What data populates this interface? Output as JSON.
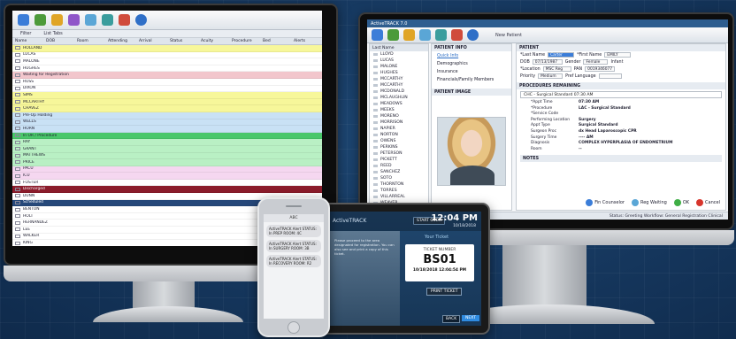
{
  "left_app": {
    "tabs": [
      "Filter",
      "List Tabs"
    ],
    "columns": [
      "Name",
      "DOB",
      "Room",
      "Attending",
      "Arrival",
      "Status",
      "Acuity",
      "Procedure",
      "Bed",
      "Alerts"
    ],
    "rows": [
      {
        "name": "HOLLAND",
        "dob": "",
        "room": "",
        "status": "",
        "color": "#f7f79a"
      },
      {
        "name": "LUCAS",
        "dob": "08/22",
        "room": "",
        "status": "",
        "color": "#ffffff"
      },
      {
        "name": "MALONE",
        "dob": "",
        "room": "",
        "status": "",
        "color": "#ffffff"
      },
      {
        "name": "HUGHES",
        "dob": "",
        "room": "",
        "status": "",
        "color": "#ffffff"
      },
      {
        "name": "Waiting for Registration",
        "dob": "",
        "room": "",
        "status": "",
        "color": "#f2c6cc"
      },
      {
        "name": "ROSS",
        "dob": "",
        "room": "",
        "status": "",
        "color": "#ffffff"
      },
      {
        "name": "DIXON",
        "dob": "",
        "room": "",
        "status": "",
        "color": "#ffffff"
      },
      {
        "name": "SIMS",
        "dob": "",
        "room": "",
        "status": "",
        "color": "#f7f79a"
      },
      {
        "name": "MCCARTHY",
        "dob": "",
        "room": "",
        "status": "",
        "color": "#f7f79a"
      },
      {
        "name": "CHAVEZ",
        "dob": "",
        "room": "",
        "status": "",
        "color": "#f7f79a"
      },
      {
        "name": "Pre-Op Holding",
        "dob": "",
        "room": "",
        "status": "",
        "color": "#c9e1f5"
      },
      {
        "name": "WELLS",
        "dob": "",
        "room": "",
        "status": "",
        "color": "#c9e1f5"
      },
      {
        "name": "HORN",
        "dob": "",
        "room": "",
        "status": "",
        "color": "#c9e1f5"
      },
      {
        "name": "In OR / Procedure",
        "dob": "",
        "room": "",
        "status": "",
        "color": "#49c76a"
      },
      {
        "name": "RAY",
        "dob": "",
        "room": "",
        "status": "",
        "color": "#b9f0c4"
      },
      {
        "name": "GRANT",
        "dob": "",
        "room": "",
        "status": "",
        "color": "#b9f0c4"
      },
      {
        "name": "MATTHEWS",
        "dob": "",
        "room": "",
        "status": "",
        "color": "#b9f0c4"
      },
      {
        "name": "PRICE",
        "dob": "",
        "room": "",
        "status": "",
        "color": "#b9f0c4"
      },
      {
        "name": "PACU",
        "dob": "",
        "room": "",
        "status": "",
        "color": "#f5d7f0"
      },
      {
        "name": "ICU",
        "dob": "",
        "room": "",
        "status": "",
        "color": "#f5d7f0"
      },
      {
        "name": "FOSTER",
        "dob": "",
        "room": "",
        "status": "",
        "color": "#ffffff"
      },
      {
        "name": "Discharged",
        "dob": "",
        "room": "",
        "status": "",
        "color": "#8b1c2b"
      },
      {
        "name": "DUNN",
        "dob": "",
        "room": "",
        "status": "",
        "color": "#ffffff"
      },
      {
        "name": "Scheduled",
        "dob": "",
        "room": "",
        "status": "",
        "color": "#26487a"
      },
      {
        "name": "BENTON",
        "dob": "",
        "room": "",
        "status": "",
        "color": "#ffffff"
      },
      {
        "name": "HOLT",
        "dob": "",
        "room": "",
        "status": "",
        "color": "#ffffff"
      },
      {
        "name": "HERNANDEZ",
        "dob": "",
        "room": "",
        "status": "",
        "color": "#ffffff"
      },
      {
        "name": "LEE",
        "dob": "",
        "room": "",
        "status": "",
        "color": "#ffffff"
      },
      {
        "name": "WALKER",
        "dob": "",
        "room": "",
        "status": "",
        "color": "#ffffff"
      },
      {
        "name": "KING",
        "dob": "",
        "room": "",
        "status": "",
        "color": "#ffffff"
      },
      {
        "name": "ROBERTS",
        "dob": "",
        "room": "",
        "status": "",
        "color": "#ffffff"
      },
      {
        "name": "YOUNG",
        "dob": "",
        "room": "",
        "status": "",
        "color": "#ffffff"
      },
      {
        "name": "SMITH",
        "dob": "",
        "room": "",
        "status": "",
        "color": "#ffffff"
      },
      {
        "name": "Cancelled",
        "dob": "",
        "room": "",
        "status": "",
        "color": "#f1b26a"
      }
    ]
  },
  "right_app": {
    "title": "ActiveTRACK 7.0",
    "tab_label": "New Patient",
    "names_header": "Last Name",
    "names": [
      "LLOYD",
      "LUCAS",
      "MALONE",
      "HUGHES",
      "MCCARTHY",
      "MCCARTHY",
      "MCDONALD",
      "MCLAUGHLIN",
      "MEADOWS",
      "MEEKS",
      "MORENO",
      "MORRISON",
      "NAPIER",
      "NORTON",
      "OWENS",
      "PERKINS",
      "PETERSON",
      "PICKETT",
      "REED",
      "SANCHEZ",
      "SOTO",
      "THORNTON",
      "TORRES",
      "VILLARREAL",
      "WEAVER",
      "WILLIAMSON"
    ],
    "patient_info_header": "PATIENT INFO",
    "info_links": [
      "Quick Info",
      "Demographics",
      "Insurance",
      "Financials/Family Members"
    ],
    "patient_image_header": "PATIENT IMAGE",
    "form_header": "PATIENT",
    "last_name_label": "*Last Name",
    "last_name_value": "Carter",
    "first_name_label": "*First Name",
    "first_name_value": "EMILY",
    "dob_label": "DOB",
    "dob_value": "07/13/1987",
    "gender_label": "Gender",
    "gender_value": "Female",
    "infant_label": "Infant",
    "location_label": "*Location",
    "location_value": "MSC Reg",
    "pan_label": "PAN",
    "pan_value": "0019346077",
    "priority_label": "Priority",
    "priority_value": "Medium",
    "pref_language_label": "Pref Language",
    "procedures_header": "PROCEDURES REMAINING",
    "procedure_value": "CHC - Surgical Standard 07:30 AM",
    "procedure_details": [
      {
        "k": "*Appt Time",
        "v": "07:30 AM"
      },
      {
        "k": "*Procedure",
        "v": "LAC - Surgical Standard"
      },
      {
        "k": "*Service Code",
        "v": ""
      },
      {
        "k": "Performing Location",
        "v": "Surgery"
      },
      {
        "k": "Appt Type",
        "v": "Surgical Standard"
      },
      {
        "k": "Surgeon Proc",
        "v": "dx Head Laparoscopic CPR"
      },
      {
        "k": "Surgery Time",
        "v": "---- AM"
      },
      {
        "k": "Diagnosis",
        "v": "COMPLEX HYPERPLASIA OF ENDOMETRIUM"
      },
      {
        "k": "Room",
        "v": "--"
      }
    ],
    "notes_header": "NOTES",
    "buttons": [
      "Fin Counselor",
      "Reg Waiting",
      "OK",
      "Cancel"
    ],
    "status_bar": "Status: Greeting    Workflow: General Registration Clinical"
  },
  "tablet": {
    "logo": "ActiveTRACK",
    "start_over": "START OVER",
    "time": "12:04 PM",
    "date": "10/18/2018",
    "message": "Please proceed to the area designated for registration. You can also see and print a copy of this ticket.",
    "your_ticket": "Your Ticket",
    "ticket_number_label": "TICKET NUMBER",
    "ticket_number": "BS01",
    "ticket_datetime": "10/18/2018 12:04:54 PM",
    "print_ticket": "PRINT TICKET",
    "back": "BACK",
    "next": "NEXT"
  },
  "phone": {
    "header": "ABC",
    "messages": [
      {
        "from": "them",
        "text": "ActiveTRACK Alert STATUS: In PREP ROOM: 4C"
      },
      {
        "from": "them",
        "text": "ActiveTRACK Alert STATUS: In SURGERY ROOM: 3B"
      },
      {
        "from": "them",
        "text": "ActiveTRACK Alert STATUS: In RECOVERY ROOM: R2"
      }
    ]
  }
}
